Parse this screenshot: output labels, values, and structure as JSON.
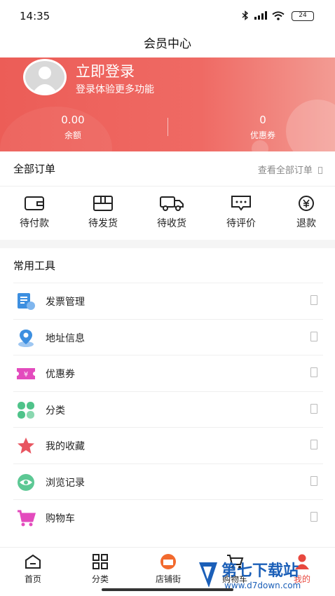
{
  "status_bar": {
    "time": "14:35",
    "battery": "24"
  },
  "nav": {
    "title": "会员中心"
  },
  "profile": {
    "login_title": "立即登录",
    "login_subtitle": "登录体验更多功能"
  },
  "stats": [
    {
      "value": "0.00",
      "label": "余额"
    },
    {
      "value": "0",
      "label": "优惠券"
    }
  ],
  "orders": {
    "title": "全部订单",
    "view_all": "查看全部订单",
    "items": [
      {
        "label": "待付款",
        "icon": "wallet-icon"
      },
      {
        "label": "待发货",
        "icon": "package-icon"
      },
      {
        "label": "待收货",
        "icon": "truck-icon"
      },
      {
        "label": "待评价",
        "icon": "comment-icon"
      },
      {
        "label": "退款",
        "icon": "refund-icon"
      }
    ]
  },
  "tools": {
    "title": "常用工具",
    "items": [
      {
        "label": "发票管理",
        "icon": "invoice-icon"
      },
      {
        "label": "地址信息",
        "icon": "location-icon"
      },
      {
        "label": "优惠券",
        "icon": "coupon-icon"
      },
      {
        "label": "分类",
        "icon": "category-icon"
      },
      {
        "label": "我的收藏",
        "icon": "star-icon"
      },
      {
        "label": "浏览记录",
        "icon": "eye-icon"
      },
      {
        "label": "购物车",
        "icon": "cart-icon"
      }
    ]
  },
  "tabbar": {
    "items": [
      {
        "label": "首页",
        "icon": "home-icon"
      },
      {
        "label": "分类",
        "icon": "grid-icon"
      },
      {
        "label": "店铺街",
        "icon": "shop-icon"
      },
      {
        "label": "购物车",
        "icon": "cart-icon"
      },
      {
        "label": "我的",
        "icon": "user-icon"
      }
    ]
  },
  "watermark": {
    "text": "第七下载站",
    "url": "www.d7down.com"
  },
  "colors": {
    "accent": "#e8483f",
    "hero_start": "#ec5d57",
    "hero_end": "#f39b93"
  }
}
